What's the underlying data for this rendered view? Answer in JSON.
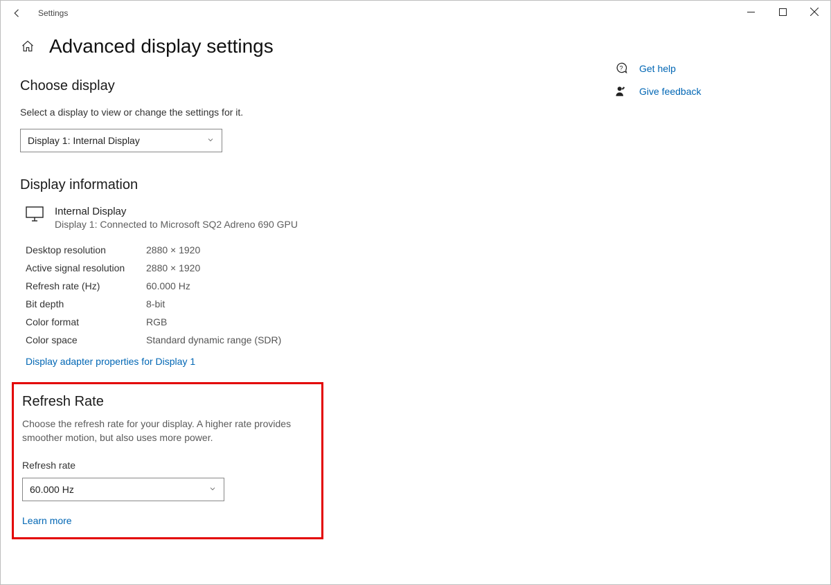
{
  "app": {
    "title": "Settings"
  },
  "header": {
    "page_title": "Advanced display settings"
  },
  "choose_display": {
    "heading": "Choose display",
    "subtext": "Select a display to view or change the settings for it.",
    "selected": "Display 1: Internal Display"
  },
  "display_info": {
    "heading": "Display information",
    "primary": "Internal Display",
    "secondary": "Display 1: Connected to Microsoft SQ2 Adreno 690 GPU",
    "rows": [
      {
        "key": "Desktop resolution",
        "val": "2880 × 1920"
      },
      {
        "key": "Active signal resolution",
        "val": "2880 × 1920"
      },
      {
        "key": "Refresh rate (Hz)",
        "val": "60.000 Hz"
      },
      {
        "key": "Bit depth",
        "val": "8-bit"
      },
      {
        "key": "Color format",
        "val": "RGB"
      },
      {
        "key": "Color space",
        "val": "Standard dynamic range (SDR)"
      }
    ],
    "adapter_link": "Display adapter properties for Display 1"
  },
  "refresh_rate": {
    "heading": "Refresh Rate",
    "description": "Choose the refresh rate for your display. A higher rate provides smoother motion, but also uses more power.",
    "label": "Refresh rate",
    "selected": "60.000 Hz",
    "learn_more": "Learn more"
  },
  "sidebar": {
    "get_help": "Get help",
    "give_feedback": "Give feedback"
  }
}
